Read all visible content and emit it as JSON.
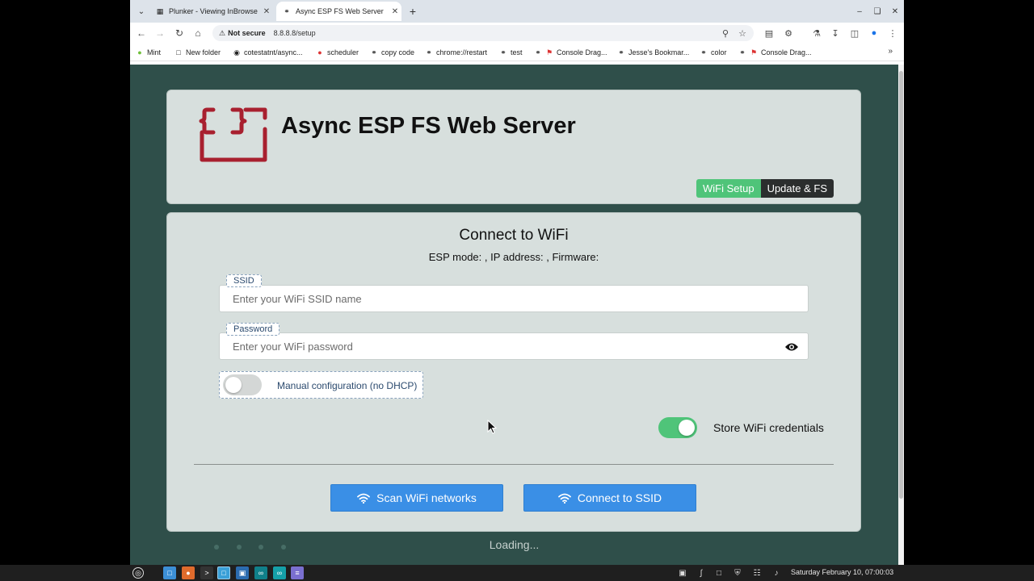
{
  "browser": {
    "tabs": [
      {
        "title": "Plunker - Viewing InBrowse",
        "favicon": "plunker-icon",
        "active": false
      },
      {
        "title": "Async ESP FS Web Server",
        "favicon": "globe-icon",
        "active": true
      }
    ],
    "address": {
      "security_text": "Not secure",
      "url": "8.8.8.8/setup"
    },
    "bookmarks": [
      {
        "label": "Mint",
        "icon": "mint-icon"
      },
      {
        "label": "New folder",
        "icon": "folder-icon"
      },
      {
        "label": "cotestatnt/async...",
        "icon": "github-icon"
      },
      {
        "label": "scheduler",
        "icon": "scheduler-icon"
      },
      {
        "label": "copy code",
        "icon": "globe-icon"
      },
      {
        "label": "chrome://restart",
        "icon": "globe-icon"
      },
      {
        "label": "test",
        "icon": "globe-icon"
      },
      {
        "label": "Console Drag...",
        "icon": "bookmark-icon"
      },
      {
        "label": "Jesse's Bookmar...",
        "icon": "globe-icon"
      },
      {
        "label": "color",
        "icon": "globe-icon"
      },
      {
        "label": "Console Drag...",
        "icon": "bookmark-icon"
      }
    ]
  },
  "header": {
    "title": "Async ESP FS Web Server",
    "nav": {
      "wifi_setup": "WiFi Setup",
      "update_fs": "Update & FS"
    }
  },
  "main": {
    "title": "Connect to WiFi",
    "esp_info": "ESP mode: , IP address: , Firmware:",
    "ssid": {
      "label": "SSID",
      "value": "",
      "placeholder": "Enter your WiFi SSID name"
    },
    "password": {
      "label": "Password",
      "value": "",
      "placeholder": "Enter your WiFi password"
    },
    "manual_config": {
      "label": "Manual configuration (no DHCP)",
      "checked": false
    },
    "store_credentials": {
      "label": "Store WiFi credentials",
      "checked": true
    },
    "scan_button": "Scan WiFi networks",
    "connect_button": "Connect to SSID"
  },
  "footer": {
    "loading_text": "Loading..."
  },
  "taskbar": {
    "clock": "Saturday February 10, 07:00:03"
  },
  "colors": {
    "page_background": "#2f4f4a",
    "card_background": "#d7dfdd",
    "accent_green": "#4fc479",
    "button_blue": "#3a8fe6",
    "logo_red": "#a8202f"
  }
}
